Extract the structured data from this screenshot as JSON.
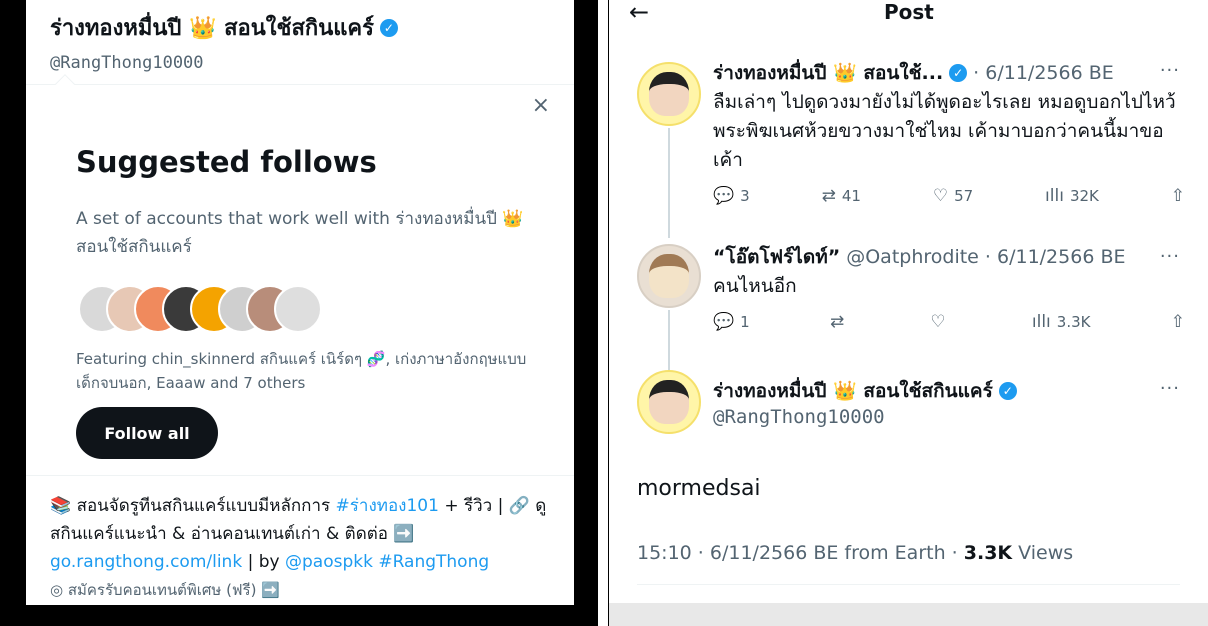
{
  "left": {
    "profile_name": "ร่างทองหมื่นปี 👑 สอนใช้สกินแคร์",
    "profile_handle": "@RangThong10000",
    "close_icon": "×",
    "suggested_title": "Suggested follows",
    "suggested_desc": "A set of accounts that work well with ร่างทองหมื่นปี 👑 สอนใช้สกินแคร์",
    "featuring_text": "Featuring chin_skinnerd สกินแคร์ เนิร์ดๆ 🧬, เก่งภาษาอังกฤษแบบเด็กจบนอก, Eaaaw and 7 others",
    "follow_all_label": "Follow all",
    "bio_line1": "📚 สอนจัดรูทีนสกินแคร์แบบมีหลักการ ",
    "bio_hashtag1": "#ร่างทอง101",
    "bio_line1b": " + รีวิว | 🔗 ดูสกินแคร์แนะนำ & อ่านคอนเทนต์เก่า & ติดต่อ ➡️ ",
    "bio_link": "go.rangthong.com/link",
    "bio_by": " | by ",
    "bio_handle": "@paospkk",
    "bio_hashtag2": " #RangThong",
    "bio_line3": "◎ สมัครรับคอนเทนต์พิเศษ (ฟรี) ➡️",
    "avatar_colors": [
      "#d9d9d9",
      "#e7c8b5",
      "#f08a5d",
      "#3a3a3a",
      "#f4a300",
      "#cfcfcf",
      "#b88d7a",
      "#dedede"
    ]
  },
  "right": {
    "back_icon": "←",
    "title": "Post",
    "more_icon": "···",
    "tweet1": {
      "name": "ร่างทองหมื่นปี 👑 สอนใช้...",
      "meta": "· 6/11/2566 BE",
      "text": "ลืมเล่าๆ ไปดูดวงมายังไม่ได้พูดอะไรเลย หมอดูบอกไปไหว้พระพิฆเนศห้วยขวางมาใช่ไหม เค้ามาบอกว่าคนนี้มาขอเค้า",
      "replies": "3",
      "retweets": "41",
      "likes": "57",
      "views": "32K"
    },
    "tweet2": {
      "name": "“โอ๊ตโฟร์ไดท์”",
      "meta": "@Oatphrodite · 6/11/2566 BE",
      "text": "คนไหนอีก",
      "replies": "1",
      "retweets": "",
      "likes": "",
      "views": "3.3K"
    },
    "tweet3": {
      "name": "ร่างทองหมื่นปี 👑 สอนใช้สกินแคร์",
      "handle": "@RangThong10000",
      "text": "mormedsai",
      "time": "15:10 · 6/11/2566 BE from Earth · ",
      "views_count": "3.3K",
      "views_label": " Views"
    }
  }
}
